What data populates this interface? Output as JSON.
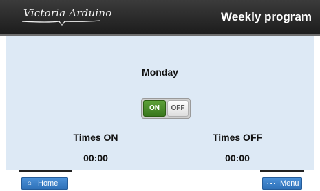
{
  "header": {
    "logo_text": "Victoria Arduino",
    "title": "Weekly program"
  },
  "main": {
    "day": "Monday",
    "toggle": {
      "on_label": "ON",
      "off_label": "OFF",
      "state": "on"
    },
    "times_on": {
      "label": "Times ON",
      "value": "00:00"
    },
    "times_off": {
      "label": "Times OFF",
      "value": "00:00"
    }
  },
  "footer": {
    "home_icon": "home-icon",
    "home_label": "Home",
    "menu_icon": "grid-dots-icon",
    "menu_label": "Menu"
  },
  "colors": {
    "header_bg": "#2b2b2b",
    "content_bg": "#dde9f5",
    "toggle_on": "#4b8d2a",
    "button_blue": "#3a80c8"
  }
}
